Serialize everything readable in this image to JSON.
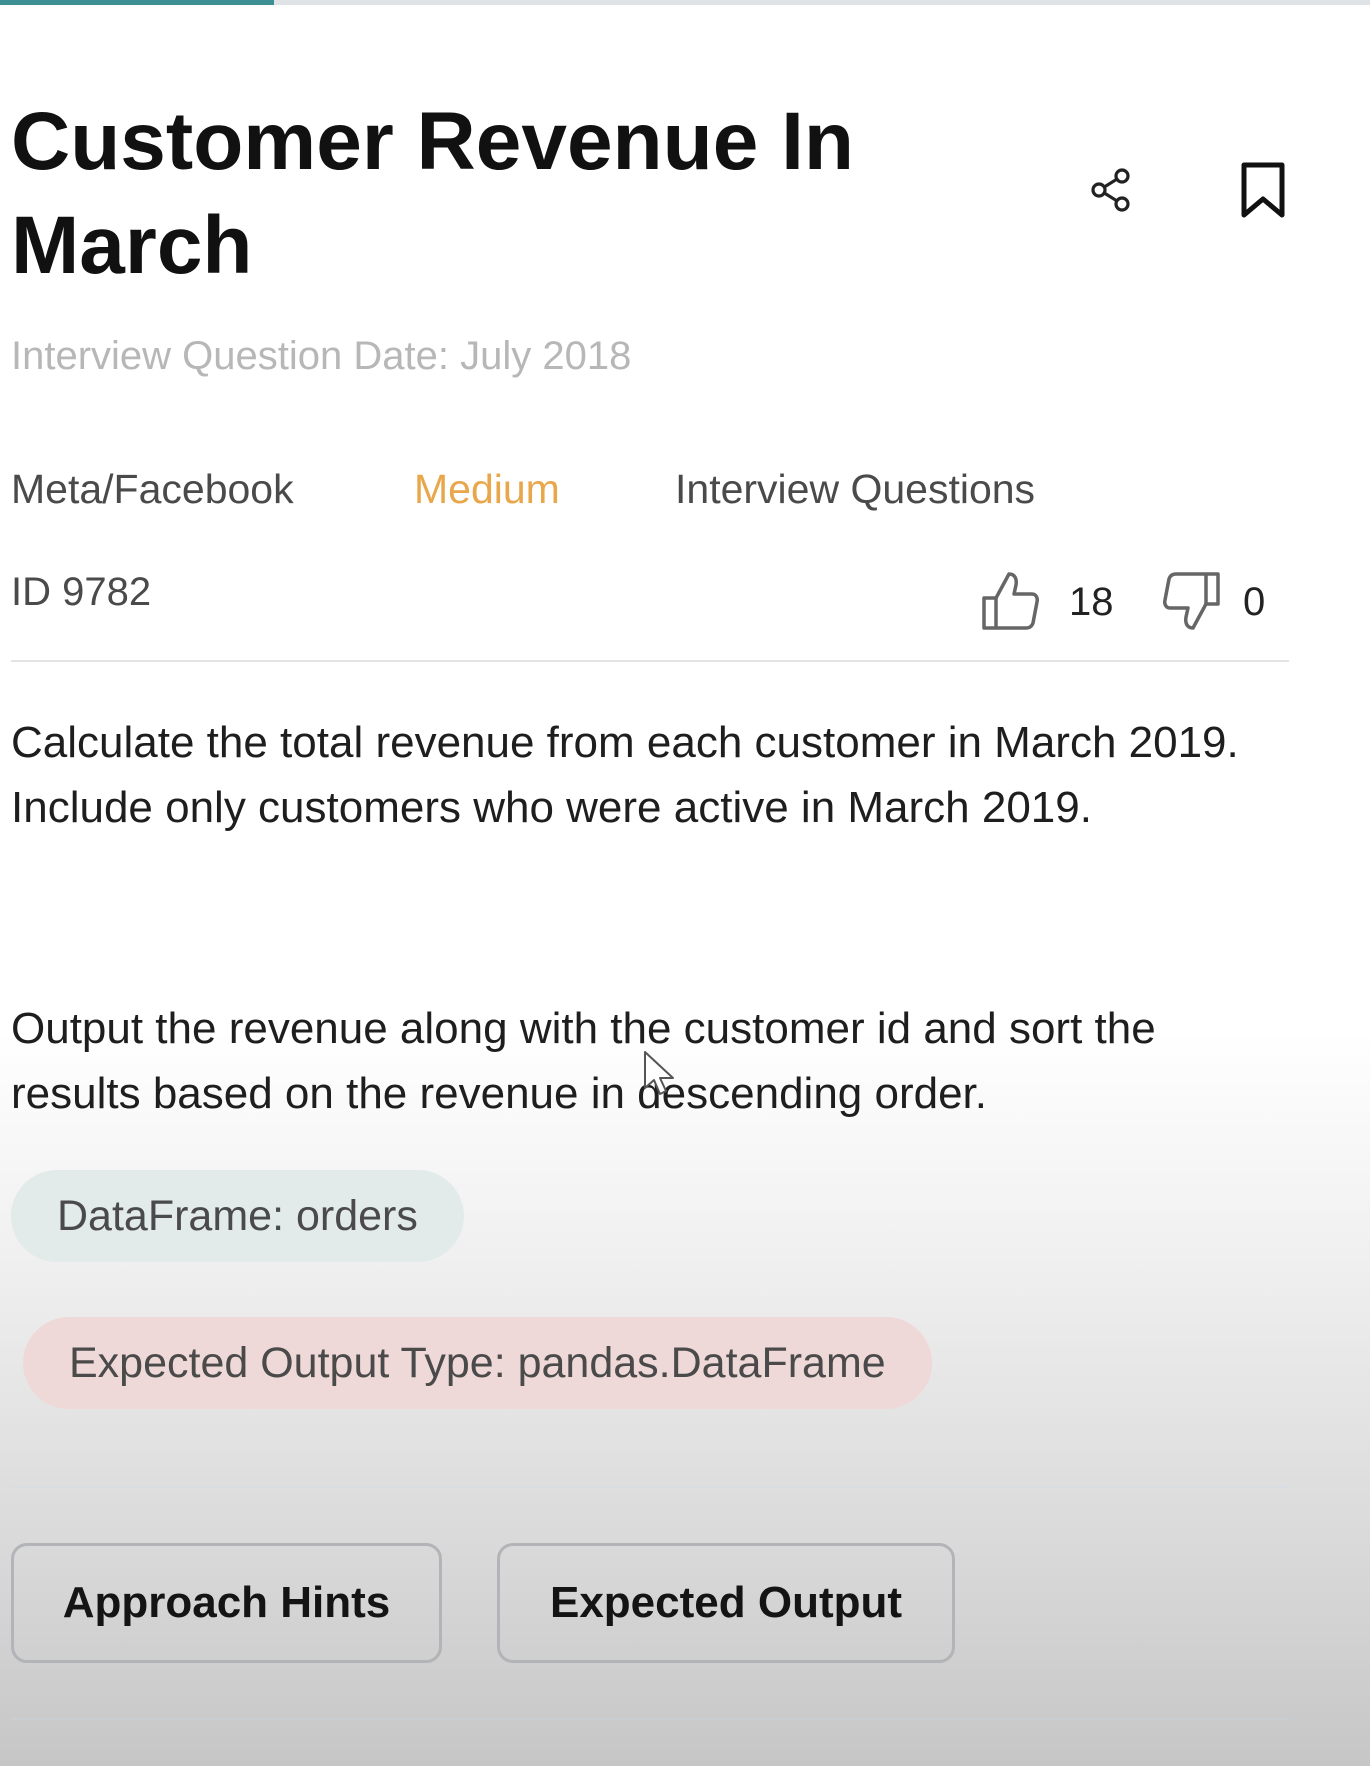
{
  "progress": {
    "fraction": 0.2
  },
  "question": {
    "title": "Customer Revenue In March",
    "interview_date": "Interview Question Date: July 2018",
    "company": "Meta/Facebook",
    "difficulty": "Medium",
    "category": "Interview Questions",
    "id_label": "ID 9782",
    "likes": "18",
    "dislikes": "0",
    "description": [
      "Calculate the total revenue from each customer in March 2019. Include only customers who were active in March 2019.",
      "Output the revenue along with the customer id and sort the results based on the revenue in descending order."
    ],
    "dataframe_label": "DataFrame: orders",
    "expected_output_type": "Expected Output Type: pandas.DataFrame"
  },
  "buttons": {
    "approach_hints": "Approach Hints",
    "expected_output": "Expected Output"
  },
  "icons": {
    "share": "share-icon",
    "bookmark": "bookmark-icon",
    "thumbs_up": "thumbs-up-icon",
    "thumbs_down": "thumbs-down-icon"
  },
  "colors": {
    "difficulty_medium": "#e9a74c",
    "progress_fill": "#3d8f93",
    "dataframe_pill_bg": "#e2ebea",
    "output_pill_bg": "#efd9d8"
  }
}
